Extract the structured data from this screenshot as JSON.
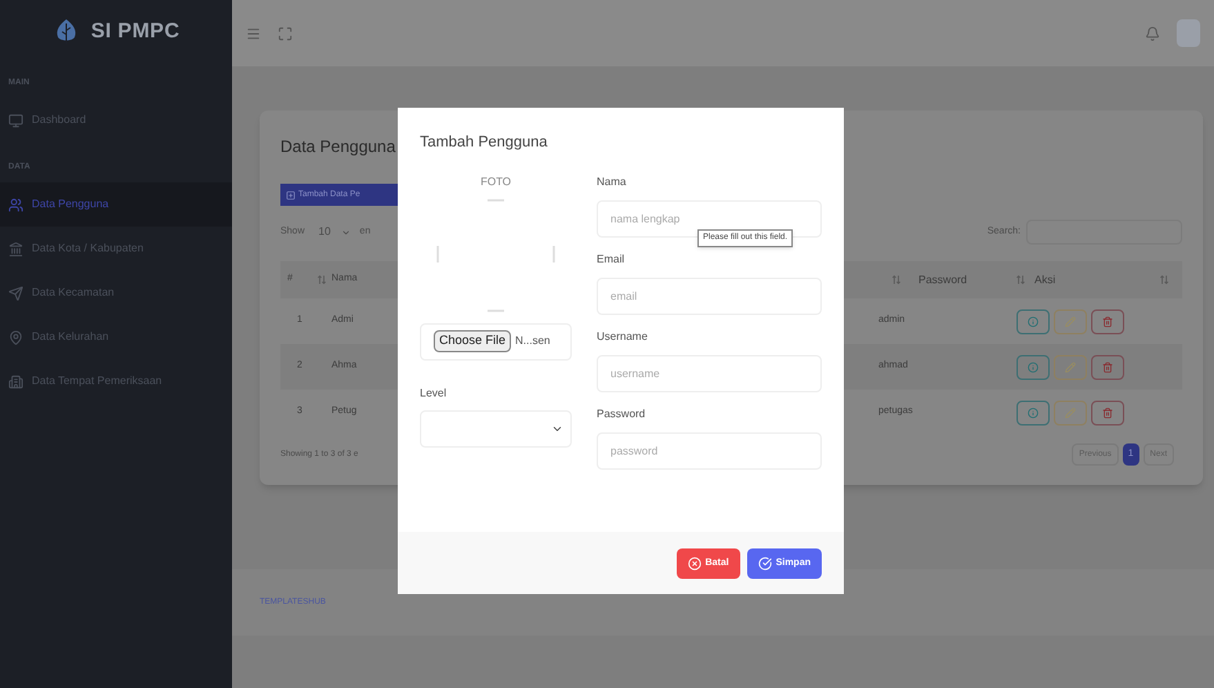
{
  "sidebar": {
    "brand": "SI PMPC",
    "sections": [
      {
        "heading": "MAIN",
        "items": [
          {
            "label": "Dashboard",
            "selected": false
          }
        ]
      },
      {
        "heading": "DATA",
        "items": [
          {
            "label": "Data Pengguna",
            "selected": true
          },
          {
            "label": "Data Kota / Kabupaten",
            "selected": false
          },
          {
            "label": "Data Kecamatan",
            "selected": false
          },
          {
            "label": "Data Kelurahan",
            "selected": false
          },
          {
            "label": "Data Tempat Pemeriksaan",
            "selected": false
          }
        ]
      }
    ]
  },
  "page": {
    "title": "Data Pengguna",
    "add_button": "Tambah Data Pe",
    "show_label": "Show",
    "page_size": "10",
    "entries_label": "en",
    "search_label": "Search:",
    "table": {
      "columns": [
        "#",
        "Nama",
        "Password",
        "Aksi"
      ],
      "rows": [
        {
          "no": "1",
          "name": "Admi",
          "password": "admin"
        },
        {
          "no": "2",
          "name": "Ahma",
          "password": "ahmad"
        },
        {
          "no": "3",
          "name": "Petug",
          "password": "petugas"
        }
      ]
    },
    "info": "Showing 1 to 3 of 3 e",
    "pagination": [
      {
        "label": "Previous",
        "selected": false
      },
      {
        "label": "1",
        "selected": true
      },
      {
        "label": "Next",
        "selected": false
      }
    ]
  },
  "footer": {
    "link": "TEMPLATESHUB"
  },
  "modal": {
    "title": "Tambah Pengguna",
    "photo_label": "FOTO",
    "file_button": "Choose File",
    "file_name": "N...sen",
    "level_label": "Level",
    "fields": [
      {
        "label": "Nama",
        "placeholder": "nama lengkap"
      },
      {
        "label": "Email",
        "placeholder": "email"
      },
      {
        "label": "Username",
        "placeholder": "username"
      },
      {
        "label": "Password",
        "placeholder": "password"
      }
    ],
    "tooltip": "Please fill out this field.",
    "buttons": [
      {
        "label": "Batal",
        "kind": "danger"
      },
      {
        "label": "Simpan",
        "kind": "primary"
      }
    ]
  }
}
